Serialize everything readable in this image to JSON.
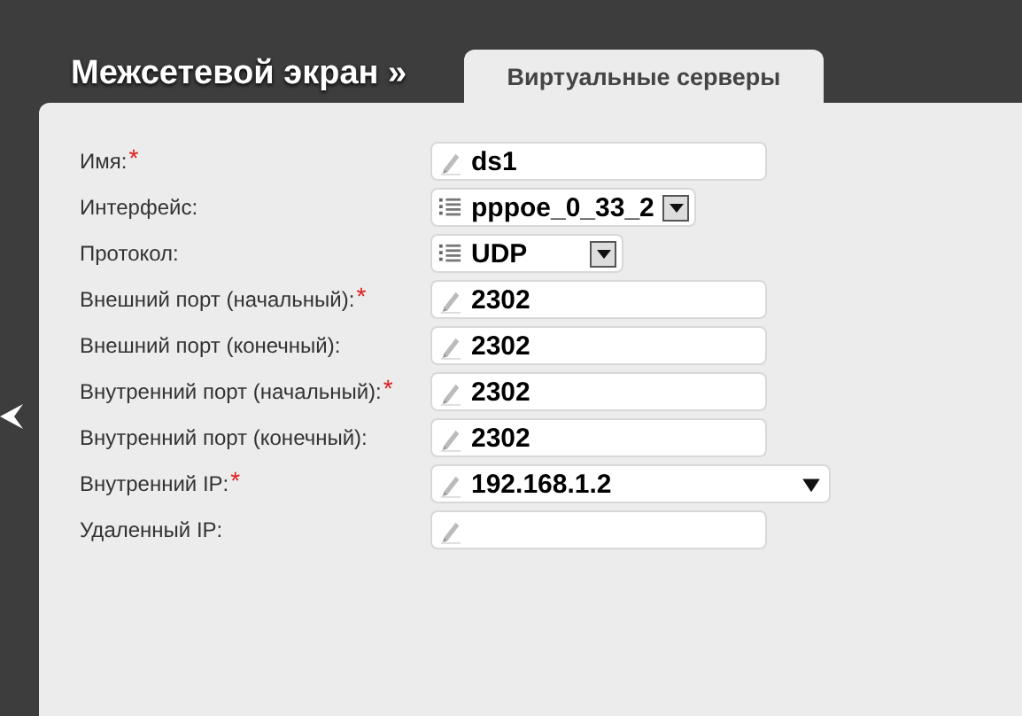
{
  "header": {
    "title": "Межсетевой экран »"
  },
  "tabs": [
    {
      "label": "Виртуальные серверы",
      "selected": true
    }
  ],
  "form": {
    "rows": [
      {
        "label": "Имя:",
        "mark": "*",
        "kind": "text",
        "value": "ds1"
      },
      {
        "label": "Интерфейс:",
        "kind": "select",
        "value": "pppoe_0_33_2"
      },
      {
        "label": "Протокол:",
        "kind": "select",
        "value": "UDP"
      },
      {
        "label": "Внешний порт (начальный):",
        "mark": "*",
        "kind": "text",
        "value": "2302"
      },
      {
        "label": "Внешний порт (конечный):",
        "kind": "text",
        "value": "2302"
      },
      {
        "label": "Внутренний порт (начальный):",
        "mark": "*",
        "kind": "text",
        "value": "2302"
      },
      {
        "label": "Внутренний порт (конечный):",
        "kind": "text",
        "value": "2302"
      },
      {
        "label": "Внутренний IP:",
        "mark": "*",
        "kind": "combo",
        "value": "192.168.1.2"
      },
      {
        "label": "Удаленный IP:",
        "kind": "text"
      }
    ]
  }
}
